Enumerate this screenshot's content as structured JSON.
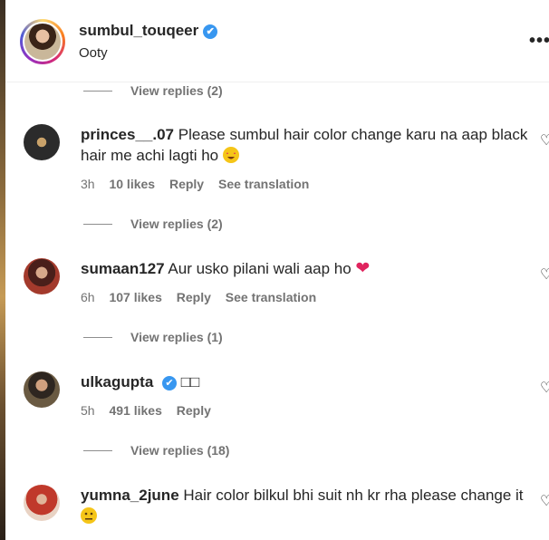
{
  "header": {
    "username": "sumbul_touqeer",
    "verified_icon": "✔",
    "location": "Ooty",
    "more_icon": "•••"
  },
  "view_replies": [
    "View replies (2)",
    "View replies (2)",
    "View replies (1)",
    "View replies (18)"
  ],
  "comments": [
    {
      "user": "princes__.07",
      "text": "Please sumbul hair color change karu na aap black hair me achi lagti ho",
      "emoji": "star-struck",
      "time": "3h",
      "likes": "10 likes",
      "reply": "Reply",
      "translation": "See translation"
    },
    {
      "user": "sumaan127",
      "text": "Aur usko pilani wali aap ho",
      "emoji": "❤",
      "time": "6h",
      "likes": "107 likes",
      "reply": "Reply",
      "translation": "See translation"
    },
    {
      "user": "ulkagupta",
      "verified_icon": "✔",
      "text": "□□",
      "time": "5h",
      "likes": "491 likes",
      "reply": "Reply"
    },
    {
      "user": "yumna_2june",
      "text": "Hair color bilkul bhi suit nh kr rha please change it",
      "emoji": "neutral-face"
    }
  ],
  "icons": {
    "like": "♡"
  },
  "colors": {
    "verified_blue": "#3897f0",
    "heart_red": "#e0245e"
  }
}
